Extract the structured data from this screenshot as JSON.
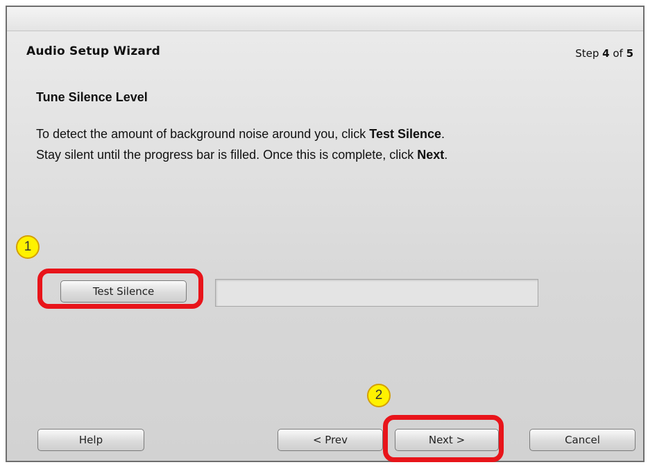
{
  "wizard": {
    "title": "Audio Setup Wizard",
    "step_prefix": "Step ",
    "step_current": "4",
    "step_mid": " of ",
    "step_total": "5"
  },
  "section": {
    "title": "Tune Silence Level",
    "line1_prefix": "To detect the amount of background noise around you, click ",
    "line1_bold": "Test Silence",
    "line1_suffix": ".",
    "line2_prefix": "Stay silent until the progress bar is filled. Once this is complete, click ",
    "line2_bold": "Next",
    "line2_suffix": "."
  },
  "controls": {
    "test_silence_label": "Test Silence",
    "progress_fraction": 0
  },
  "footer": {
    "help_label": "Help",
    "prev_label": "< Prev",
    "next_label": "Next >",
    "cancel_label": "Cancel"
  },
  "annotations": {
    "marker1": "1",
    "marker2": "2",
    "highlight_color": "#e8141a",
    "marker_color": "#fff200"
  }
}
